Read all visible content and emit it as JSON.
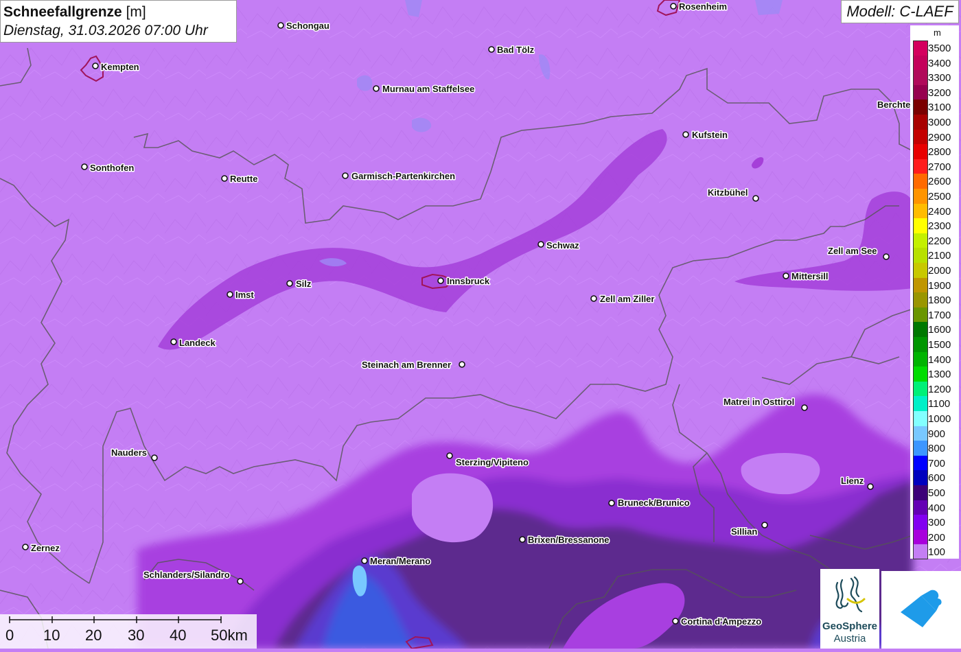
{
  "title": {
    "variable": "Schneefallgrenze",
    "unit": "[m]",
    "datetime": "Dienstag, 31.03.2026 07:00 Uhr"
  },
  "model": "Modell: C-LAEF",
  "legend": {
    "unit": "m",
    "items": [
      {
        "value": "3500",
        "color": "#d4005e"
      },
      {
        "value": "3400",
        "color": "#c4005a"
      },
      {
        "value": "3300",
        "color": "#b00a5a"
      },
      {
        "value": "3200",
        "color": "#96004e"
      },
      {
        "value": "3100",
        "color": "#7a0000"
      },
      {
        "value": "3000",
        "color": "#a80000"
      },
      {
        "value": "2900",
        "color": "#c40000"
      },
      {
        "value": "2800",
        "color": "#e80000"
      },
      {
        "value": "2700",
        "color": "#ff1c1c"
      },
      {
        "value": "2600",
        "color": "#ff6a00"
      },
      {
        "value": "2500",
        "color": "#ff9400"
      },
      {
        "value": "2400",
        "color": "#ffbc00"
      },
      {
        "value": "2300",
        "color": "#ffff00"
      },
      {
        "value": "2200",
        "color": "#c4f000"
      },
      {
        "value": "2100",
        "color": "#b8e000"
      },
      {
        "value": "2000",
        "color": "#c8c800"
      },
      {
        "value": "1900",
        "color": "#c09600"
      },
      {
        "value": "1800",
        "color": "#9a9600"
      },
      {
        "value": "1700",
        "color": "#6a9600"
      },
      {
        "value": "1600",
        "color": "#007800"
      },
      {
        "value": "1500",
        "color": "#009600"
      },
      {
        "value": "1400",
        "color": "#00b400"
      },
      {
        "value": "1300",
        "color": "#00dc00"
      },
      {
        "value": "1200",
        "color": "#00f078"
      },
      {
        "value": "1100",
        "color": "#00f0c8"
      },
      {
        "value": "1000",
        "color": "#82ffff"
      },
      {
        "value": "900",
        "color": "#78c8ff"
      },
      {
        "value": "800",
        "color": "#3c96ff"
      },
      {
        "value": "700",
        "color": "#0000ff"
      },
      {
        "value": "600",
        "color": "#0000be"
      },
      {
        "value": "500",
        "color": "#3c0078"
      },
      {
        "value": "400",
        "color": "#6400b4"
      },
      {
        "value": "300",
        "color": "#8200f0"
      },
      {
        "value": "200",
        "color": "#a800dc"
      },
      {
        "value": "100",
        "color": "#c47ef4"
      }
    ]
  },
  "scale_bar": {
    "labels": [
      "0",
      "10",
      "20",
      "30",
      "40",
      "50km"
    ]
  },
  "cities": [
    {
      "name": "Rosenheim"
    },
    {
      "name": "Schongau"
    },
    {
      "name": "Bad Tölz"
    },
    {
      "name": "Kempten"
    },
    {
      "name": "Murnau am Staffelsee"
    },
    {
      "name": "Berchte"
    },
    {
      "name": "Kufstein"
    },
    {
      "name": "Sonthofen"
    },
    {
      "name": "Reutte"
    },
    {
      "name": "Garmisch-Partenkirchen"
    },
    {
      "name": "Kitzbühel"
    },
    {
      "name": "Schwaz"
    },
    {
      "name": "Zell am See"
    },
    {
      "name": "Mittersill"
    },
    {
      "name": "Innsbruck"
    },
    {
      "name": "Silz"
    },
    {
      "name": "Imst"
    },
    {
      "name": "Zell am Ziller"
    },
    {
      "name": "Landeck"
    },
    {
      "name": "Steinach am Brenner"
    },
    {
      "name": "Matrei in Osttirol"
    },
    {
      "name": "Nauders"
    },
    {
      "name": "Sterzing/Vipiteno"
    },
    {
      "name": "Lienz"
    },
    {
      "name": "Bruneck/Brunico"
    },
    {
      "name": "Sillian"
    },
    {
      "name": "Brixen/Bressanone"
    },
    {
      "name": "Zernez"
    },
    {
      "name": "Meran/Merano"
    },
    {
      "name": "Schlanders/Silandro"
    },
    {
      "name": "Cortina d'Ampezzo"
    }
  ],
  "logos": {
    "geosphere_line1": "GeoSphere",
    "geosphere_line2": "Austria"
  }
}
